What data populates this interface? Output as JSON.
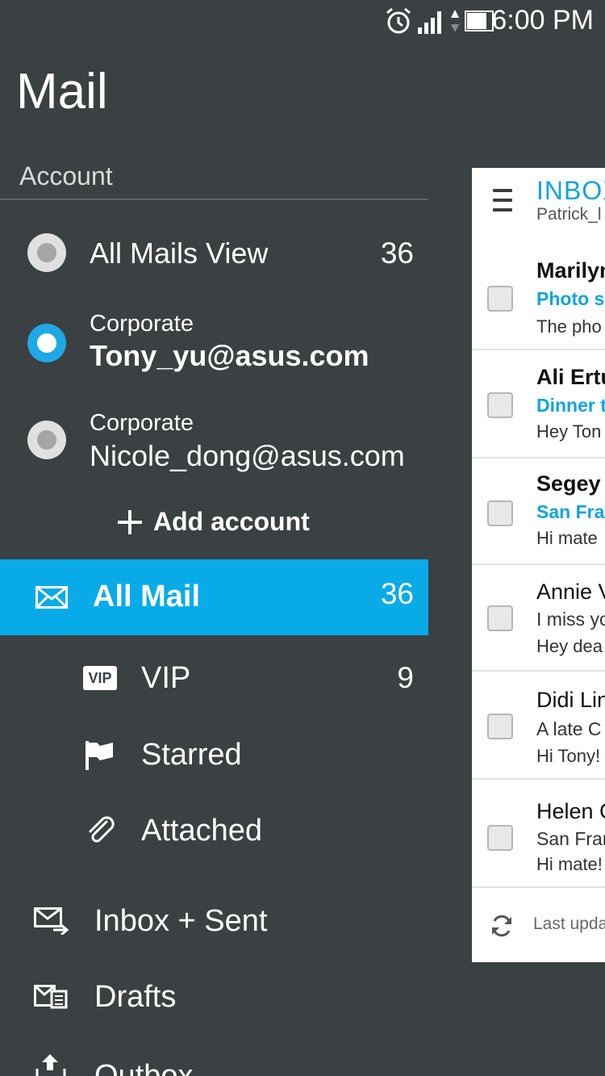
{
  "status_bar": {
    "time": "6:00 PM",
    "icons": [
      "alarm-icon",
      "signal-icon",
      "data-arrows-icon",
      "battery-icon"
    ]
  },
  "app": {
    "title": "Mail"
  },
  "account_section": {
    "label": "Account"
  },
  "accounts": [
    {
      "name": "All Mails View",
      "count": "36",
      "selected": false
    },
    {
      "type": "Corporate",
      "email": "Tony_yu@asus.com",
      "selected": true
    },
    {
      "type": "Corporate",
      "email": "Nicole_dong@asus.com",
      "selected": false
    }
  ],
  "add_account": {
    "label": "Add account"
  },
  "nav": {
    "all_mail": {
      "label": "All Mail",
      "count": "36",
      "icon": "envelope-icon"
    },
    "vip": {
      "label": "VIP",
      "count": "9",
      "badge": "VIP"
    },
    "starred": {
      "label": "Starred",
      "icon": "flag-icon"
    },
    "attached": {
      "label": "Attached",
      "icon": "paperclip-icon"
    },
    "inbox_sent": {
      "label": "Inbox + Sent",
      "icon": "inbox-sent-icon"
    },
    "drafts": {
      "label": "Drafts",
      "icon": "drafts-icon"
    },
    "outbox": {
      "label": "Outbox",
      "icon": "outbox-icon"
    }
  },
  "mail_panel": {
    "title": "INBOX",
    "subtitle": "Patrick_l",
    "messages": [
      {
        "sender": "Marilyn",
        "subject": "Photo s",
        "preview": "The pho",
        "unread": true
      },
      {
        "sender": "Ali Ertu",
        "subject": "Dinner t",
        "preview": "Hey Ton",
        "unread": true
      },
      {
        "sender": "Segey",
        "subject": "San Fra",
        "preview": "Hi mate",
        "unread": true
      },
      {
        "sender": "Annie V",
        "subject": "I miss yo",
        "preview": "Hey dea",
        "unread": false
      },
      {
        "sender": "Didi Lin",
        "subject": "A late C",
        "preview": "Hi Tony!",
        "unread": false
      },
      {
        "sender": "Helen C",
        "subject": "San Fran",
        "preview": "Hi mate!",
        "unread": false
      }
    ],
    "footer": "Last upda"
  },
  "colors": {
    "background": "#3b4042",
    "accent": "#08abe8",
    "panel": "#ffffff"
  }
}
